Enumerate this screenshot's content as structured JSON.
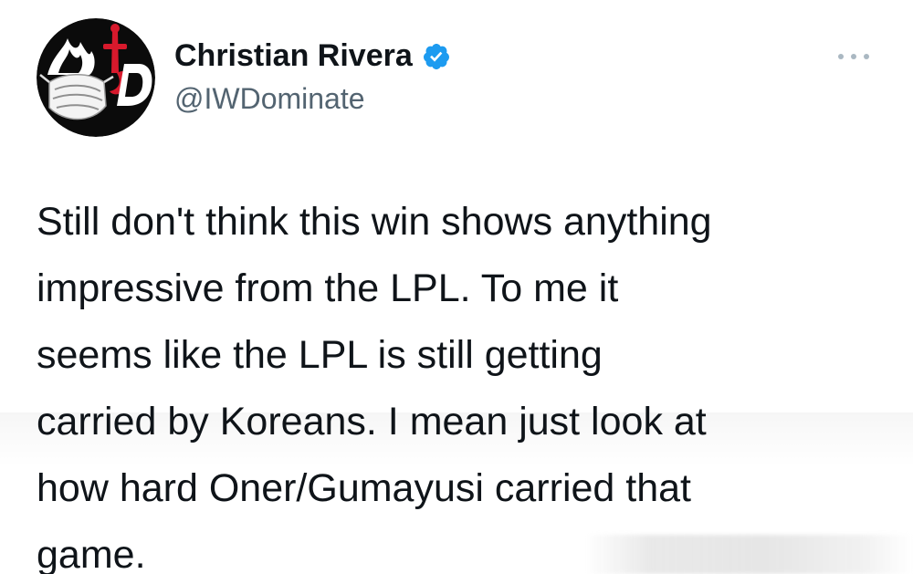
{
  "author": {
    "display_name": "Christian Rivera",
    "handle": "@IWDominate",
    "verified": true,
    "avatar_icon": "iwd-logo-icon"
  },
  "menu": {
    "icon": "more-options-icon"
  },
  "tweet": {
    "lines": [
      "Still don't think this win shows anything",
      "impressive from the LPL.  To me it",
      "seems like the LPL is still getting",
      "carried by Koreans.  I mean just look at",
      "how hard Oner/Gumayusi carried that",
      "game."
    ]
  },
  "colors": {
    "text": "#0f1419",
    "secondary_text": "#536471",
    "verified_badge": "#1d9bf0",
    "avatar_background": "#0b0b0b",
    "avatar_accent": "#d7192c"
  }
}
